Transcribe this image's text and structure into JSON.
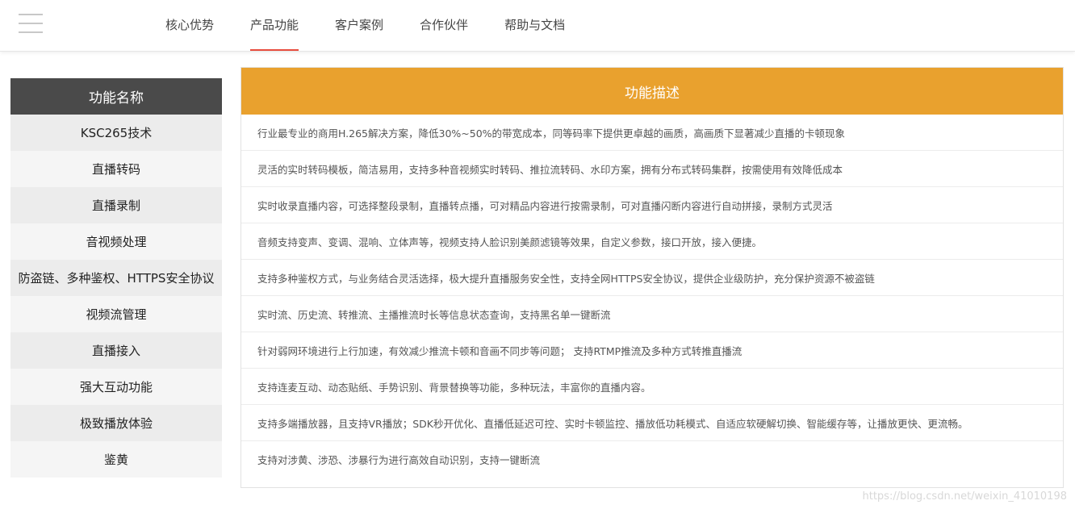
{
  "nav": {
    "items": [
      "核心优势",
      "产品功能",
      "客户案例",
      "合作伙伴",
      "帮助与文档"
    ],
    "active": "产品功能"
  },
  "table": {
    "name_header": "功能名称",
    "desc_header": "功能描述",
    "rows": [
      {
        "name": "KSC265技术",
        "desc": "行业最专业的商用H.265解决方案，降低30%~50%的带宽成本，同等码率下提供更卓越的画质，高画质下显著减少直播的卡顿现象"
      },
      {
        "name": "直播转码",
        "desc": "灵活的实时转码模板，简洁易用，支持多种音视频实时转码、推拉流转码、水印方案，拥有分布式转码集群，按需使用有效降低成本"
      },
      {
        "name": "直播录制",
        "desc": "实时收录直播内容，可选择整段录制，直播转点播，可对精品内容进行按需录制，可对直播闪断内容进行自动拼接，录制方式灵活"
      },
      {
        "name": "音视频处理",
        "desc": "音频支持变声、变调、混响、立体声等，视频支持人脸识别美颜滤镜等效果，自定义参数，接口开放，接入便捷。"
      },
      {
        "name": "防盗链、多种鉴权、HTTPS安全协议",
        "desc": "支持多种鉴权方式，与业务结合灵活选择，极大提升直播服务安全性，支持全网HTTPS安全协议，提供企业级防护，充分保护资源不被盗链"
      },
      {
        "name": "视频流管理",
        "desc": "实时流、历史流、转推流、主播推流时长等信息状态查询，支持黑名单一键断流"
      },
      {
        "name": "直播接入",
        "desc": "针对弱网环境进行上行加速，有效减少推流卡顿和音画不同步等问题； 支持RTMP推流及多种方式转推直播流"
      },
      {
        "name": "强大互动功能",
        "desc": "支持连麦互动、动态贴纸、手势识别、背景替换等功能，多种玩法，丰富你的直播内容。"
      },
      {
        "name": "极致播放体验",
        "desc": "支持多端播放器，且支持VR播放；SDK秒开优化、直播低延迟可控、实时卡顿监控、播放低功耗模式、自适应软硬解切换、智能缓存等，让播放更快、更流畅。"
      },
      {
        "name": "鉴黄",
        "desc": "支持对涉黄、涉恐、涉暴行为进行高效自动识别，支持一键断流"
      }
    ]
  },
  "watermark": "https://blog.csdn.net/weixin_41010198",
  "colors": {
    "name_header_bg": "#4a4a4a",
    "desc_header_bg": "#e9a12e",
    "active_underline": "#e84c3d"
  }
}
